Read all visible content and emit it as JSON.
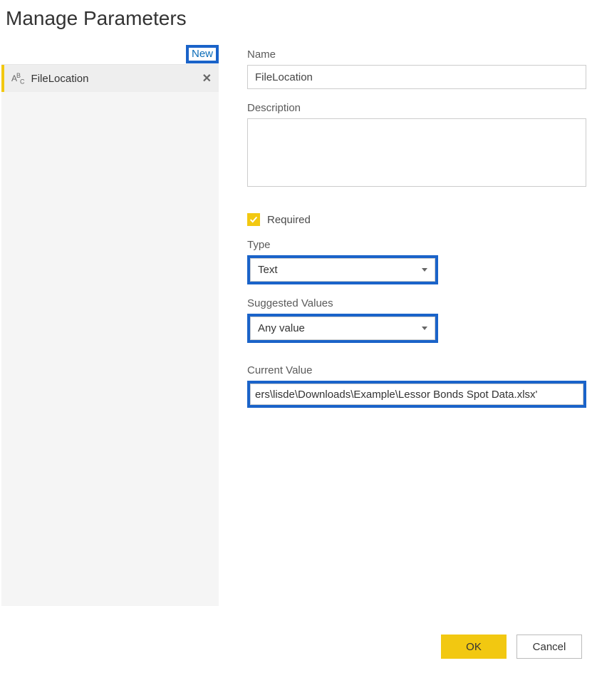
{
  "title": "Manage Parameters",
  "leftPanel": {
    "newLink": "New",
    "items": [
      {
        "name": "FileLocation"
      }
    ]
  },
  "form": {
    "nameLabel": "Name",
    "nameValue": "FileLocation",
    "descriptionLabel": "Description",
    "descriptionValue": "",
    "requiredLabel": "Required",
    "requiredChecked": true,
    "typeLabel": "Type",
    "typeValue": "Text",
    "suggestedLabel": "Suggested Values",
    "suggestedValue": "Any value",
    "currentLabel": "Current Value",
    "currentValue": "ers\\lisde\\Downloads\\Example\\Lessor Bonds Spot Data.xlsx'"
  },
  "buttons": {
    "ok": "OK",
    "cancel": "Cancel"
  }
}
